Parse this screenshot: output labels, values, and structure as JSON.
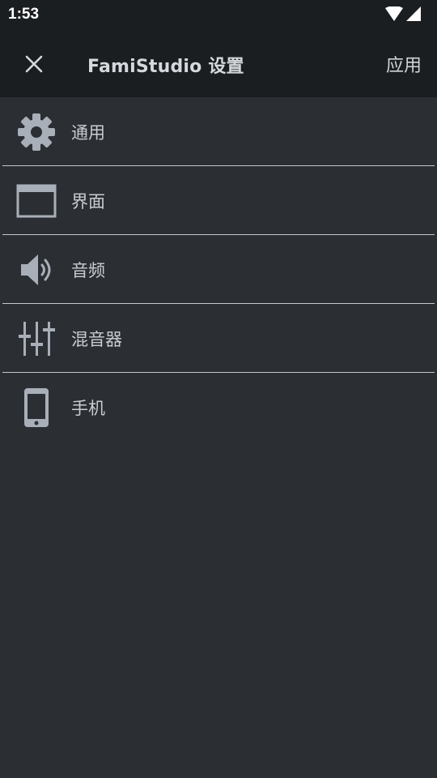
{
  "status_bar": {
    "time": "1:53",
    "icons": [
      "wifi-icon",
      "cell-signal-icon"
    ]
  },
  "app_bar": {
    "title": "FamiStudio 设置",
    "apply_label": "应用",
    "close_icon": "close-icon"
  },
  "settings_list": {
    "items": [
      {
        "label": "通用",
        "icon": "gear-icon"
      },
      {
        "label": "界面",
        "icon": "window-icon"
      },
      {
        "label": "音频",
        "icon": "speaker-icon"
      },
      {
        "label": "混音器",
        "icon": "mixer-sliders-icon"
      },
      {
        "label": "手机",
        "icon": "phone-icon"
      }
    ]
  },
  "colors": {
    "background": "#2b2f34",
    "bar": "#1b1e21",
    "text": "#c9cdd3",
    "icon": "#a9afb8",
    "divider": "#c5c8cc"
  }
}
